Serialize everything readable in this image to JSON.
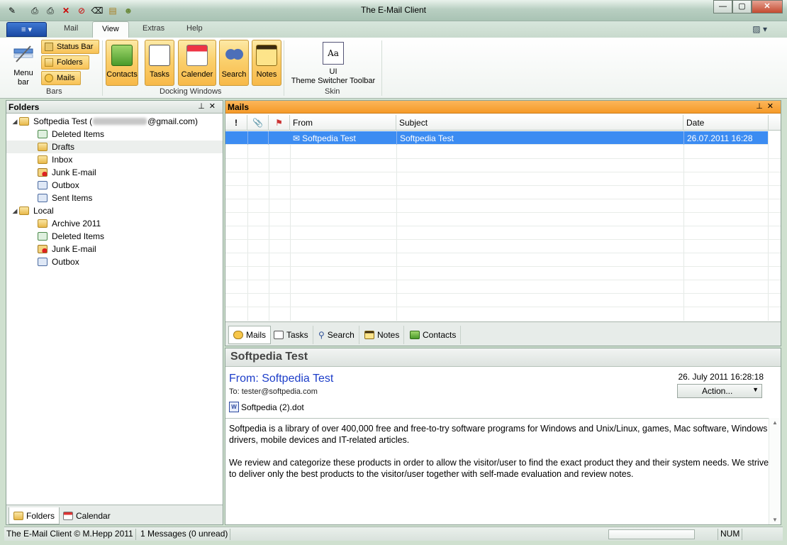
{
  "window": {
    "title": "The E-Mail Client",
    "controls": {
      "minimize": "—",
      "maximize": "▢",
      "close": "✕"
    }
  },
  "quick_access": [
    "edit-icon",
    "print-icon",
    "print-preview-icon",
    "delete-icon",
    "block-icon",
    "junk-icon",
    "note-icon",
    "contacts-icon"
  ],
  "ribbon": {
    "app_button": "≡ ▾",
    "tabs": [
      "Mail",
      "View",
      "Extras",
      "Help"
    ],
    "active_tab": "View",
    "groups": {
      "bars": {
        "label": "Bars",
        "menu_bar_label": "Menu bar",
        "status_bar_label": "Status Bar",
        "folders_label": "Folders",
        "mails_label": "Mails"
      },
      "docking": {
        "label": "Docking Windows",
        "contacts": "Contacts",
        "tasks": "Tasks",
        "calender": "Calender",
        "search": "Search",
        "notes": "Notes"
      },
      "skin": {
        "label": "Skin",
        "ui_label": "UI",
        "theme_label": "Theme Switcher Toolbar",
        "icon_text": "Aa"
      }
    }
  },
  "folders_pane": {
    "title": "Folders",
    "accounts": [
      {
        "name_prefix": "Softpedia Test (",
        "name_suffix": "@gmail.com)",
        "folders": [
          "Deleted Items",
          "Drafts",
          "Inbox",
          "Junk E-mail",
          "Outbox",
          "Sent Items"
        ]
      },
      {
        "name": "Local",
        "folders": [
          "Archive 2011",
          "Deleted Items",
          "Junk E-mail",
          "Outbox"
        ]
      }
    ],
    "selected_folder": "Drafts",
    "bottom_tabs": [
      "Folders",
      "Calendar"
    ]
  },
  "mails_pane": {
    "title": "Mails",
    "columns": [
      "!",
      "📎",
      "⚑",
      "From",
      "Subject",
      "Date"
    ],
    "rows": [
      {
        "from": "Softpedia Test",
        "subject": "Softpedia Test",
        "date": "26.07.2011 16:28"
      }
    ],
    "tabs": [
      "Mails",
      "Tasks",
      "Search",
      "Notes",
      "Contacts"
    ]
  },
  "reading_pane": {
    "subject": "Softpedia Test",
    "from": "From: Softpedia Test",
    "to": "To: tester@softpedia.com",
    "date": "26. July 2011 16:28:18",
    "action_label": "Action...",
    "attachment": "Softpedia (2).dot",
    "body": [
      "Softpedia is a library of over 400,000 free and free-to-try software programs for Windows and Unix/Linux, games, Mac software, Windows drivers, mobile devices and IT-related articles.",
      "We review and categorize these products in order to allow the visitor/user to find the exact product they and their system needs. We strive to deliver only the best products to the visitor/user together with self-made evaluation and review notes."
    ]
  },
  "statusbar": {
    "copyright": "The E-Mail Client © M.Hepp 2011",
    "messages": "1 Messages (0 unread)",
    "num": "NUM"
  },
  "colors": {
    "accent_orange": "#f59a28",
    "selection_blue": "#3c8cf2",
    "from_blue": "#1d3ec9"
  }
}
